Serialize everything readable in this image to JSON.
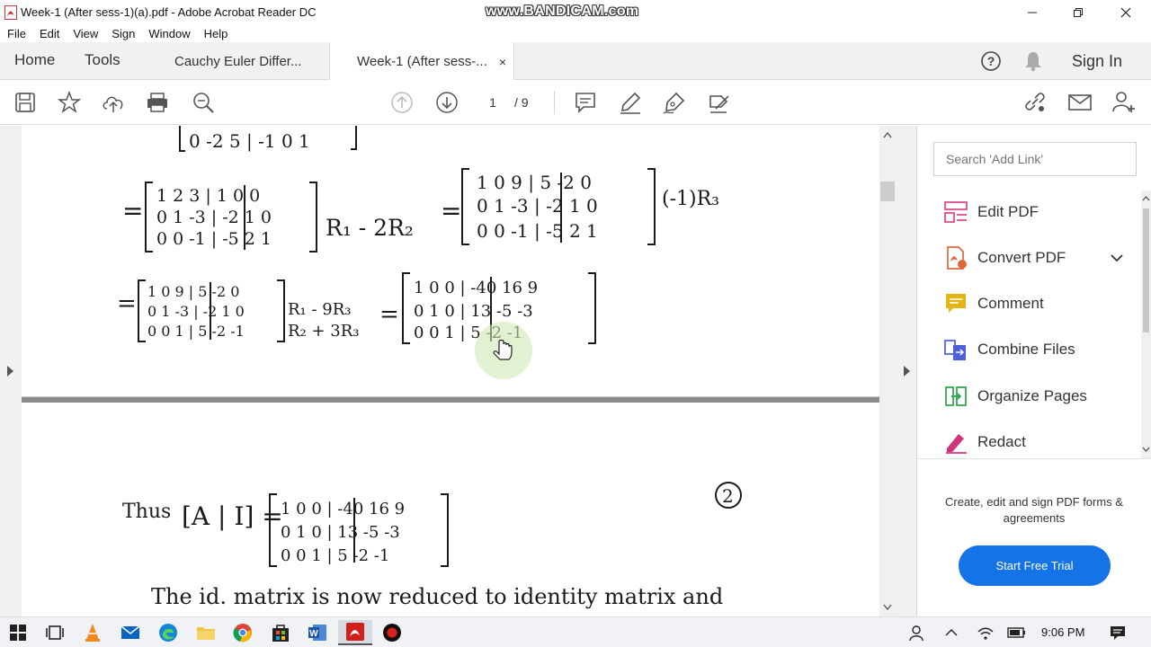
{
  "window": {
    "title": "Week-1 (After sess-1)(a).pdf - Adobe Acrobat Reader DC",
    "watermark": "www.BANDICAM.com"
  },
  "menu": [
    "File",
    "Edit",
    "View",
    "Sign",
    "Window",
    "Help"
  ],
  "tabs": {
    "home": "Home",
    "tools": "Tools",
    "docs": [
      "Cauchy Euler Differ...",
      "Week-1 (After sess-..."
    ],
    "close_glyph": "×",
    "sign_in": "Sign In"
  },
  "toolbar": {
    "current_page": "1",
    "total_pages": "/ 9"
  },
  "document": {
    "page1_lines": [
      "0 -2  5 | -1  0  1",
      "1 2 3 | 1 0 0",
      "0 1 -3 | -2 1 0",
      "0 0 -1 | -5 2 1",
      "R₁ - 2R₂",
      "1 0 9 | 5 -2 0",
      "0 1 -3 | -2 1 0",
      "0 0 -1 | -5 2 1",
      "(-1)R₃",
      "1 0 9 | 5 -2 0",
      "0 1 -3 | -2 1 0",
      "0 0 1 | 5 -2 -1",
      "R₁ - 9R₃",
      "R₂ + 3R₃",
      "1 0 0 | -40 16 9",
      "0 1 0 | 13 -5 -3",
      "0 0 1 | 5 -2 -1"
    ],
    "page2": {
      "page_number": "2",
      "thus": "Thus",
      "ai": "[A | I] =",
      "rows": [
        "1 0 0 | -40 16 9",
        "0 1 0 | 13 -5 -3",
        "0 0 1 | 5 -2 -1"
      ],
      "sentence": "The id. matrix is now reduced to identity matrix and"
    }
  },
  "right_panel": {
    "search_placeholder": "Search 'Add Link'",
    "tools": [
      "Edit PDF",
      "Convert PDF",
      "Comment",
      "Combine Files",
      "Organize Pages",
      "Redact"
    ],
    "promo": "Create, edit and sign PDF forms & agreements",
    "trial_button": "Start Free Trial",
    "colors": {
      "trial": "#1473e6",
      "edit": "#e04b8a",
      "convert": "#e0663a",
      "comment": "#e3b514",
      "combine": "#4b5fd6",
      "organize": "#27a34a",
      "redact": "#d2347c"
    }
  },
  "taskbar": {
    "time": "9:06 PM"
  }
}
